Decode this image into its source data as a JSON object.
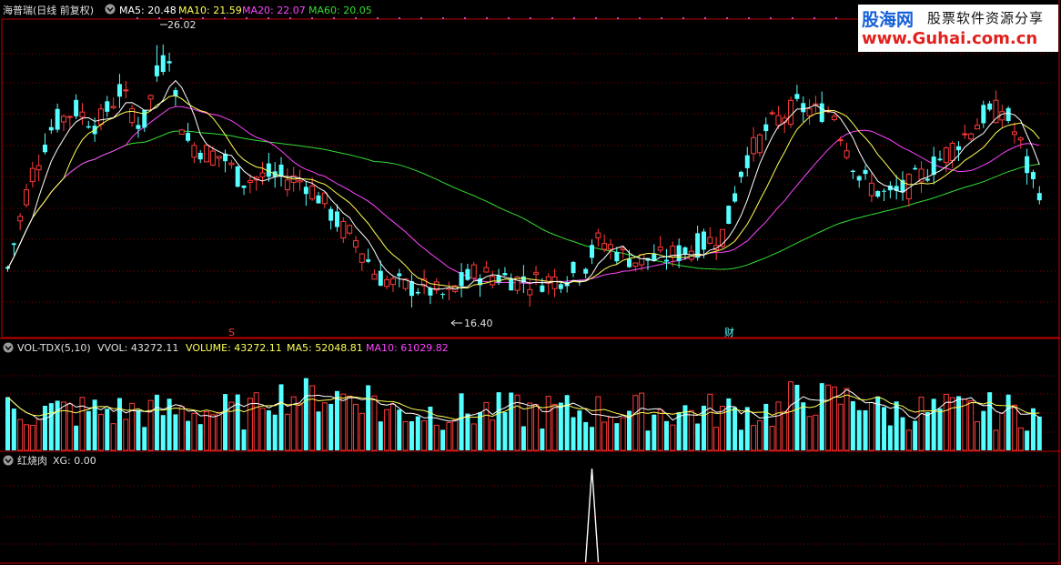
{
  "main_panel": {
    "title": "海普瑞(日线 前复权)",
    "ma5_label": "MA5: 20.48",
    "ma10_label": "MA10: 21.59",
    "ma20_label": "MA20: 22.07",
    "ma60_label": "MA60: 20.05",
    "high_marker": "26.02",
    "low_marker": "16.40",
    "event_marker_1": "S",
    "event_marker_2": "财"
  },
  "volume_panel": {
    "indicator_label": "VOL-TDX(5,10)",
    "vvol_label": "VVOL: 43272.11",
    "volume_label": "VOLUME: 43272.11",
    "ma5_label": "MA5: 52048.81",
    "ma10_label": "MA10: 61029.82"
  },
  "indicator_panel": {
    "label": "红烧肉",
    "xg_label": "XG: 0.00"
  },
  "watermark": {
    "brand": "股海网",
    "slogan": "股票软件资源分享",
    "url": "www.Guhai.com.cn"
  },
  "colors": {
    "up": "#ff3a3a",
    "down": "#55ffff",
    "ma5": "#ffffff",
    "ma10": "#ffff55",
    "ma20": "#ff44ff",
    "ma60": "#33dd33",
    "grid": "#880000",
    "divider": "#c00000"
  },
  "chart_data": [
    {
      "type": "candlestick",
      "title": "海普瑞(日线 前复权)",
      "ylim": [
        15.0,
        27.0
      ],
      "annotations": [
        {
          "text": "26.02",
          "value": 26.02,
          "kind": "period-high"
        },
        {
          "text": "16.40",
          "value": 16.4,
          "kind": "period-low"
        }
      ],
      "moving_averages": [
        {
          "name": "MA5",
          "last": 20.48
        },
        {
          "name": "MA10",
          "last": 21.59
        },
        {
          "name": "MA20",
          "last": 22.07
        },
        {
          "name": "MA60",
          "last": 20.05
        }
      ]
    },
    {
      "type": "bar",
      "title": "VOL-TDX(5,10)",
      "series": [
        {
          "name": "VOLUME",
          "last": 43272.11
        },
        {
          "name": "MA5",
          "last": 52048.81
        },
        {
          "name": "MA10",
          "last": 61029.82
        }
      ]
    },
    {
      "type": "line",
      "title": "红烧肉",
      "series": [
        {
          "name": "XG",
          "last": 0.0,
          "signal_value": 1.0
        }
      ]
    }
  ]
}
